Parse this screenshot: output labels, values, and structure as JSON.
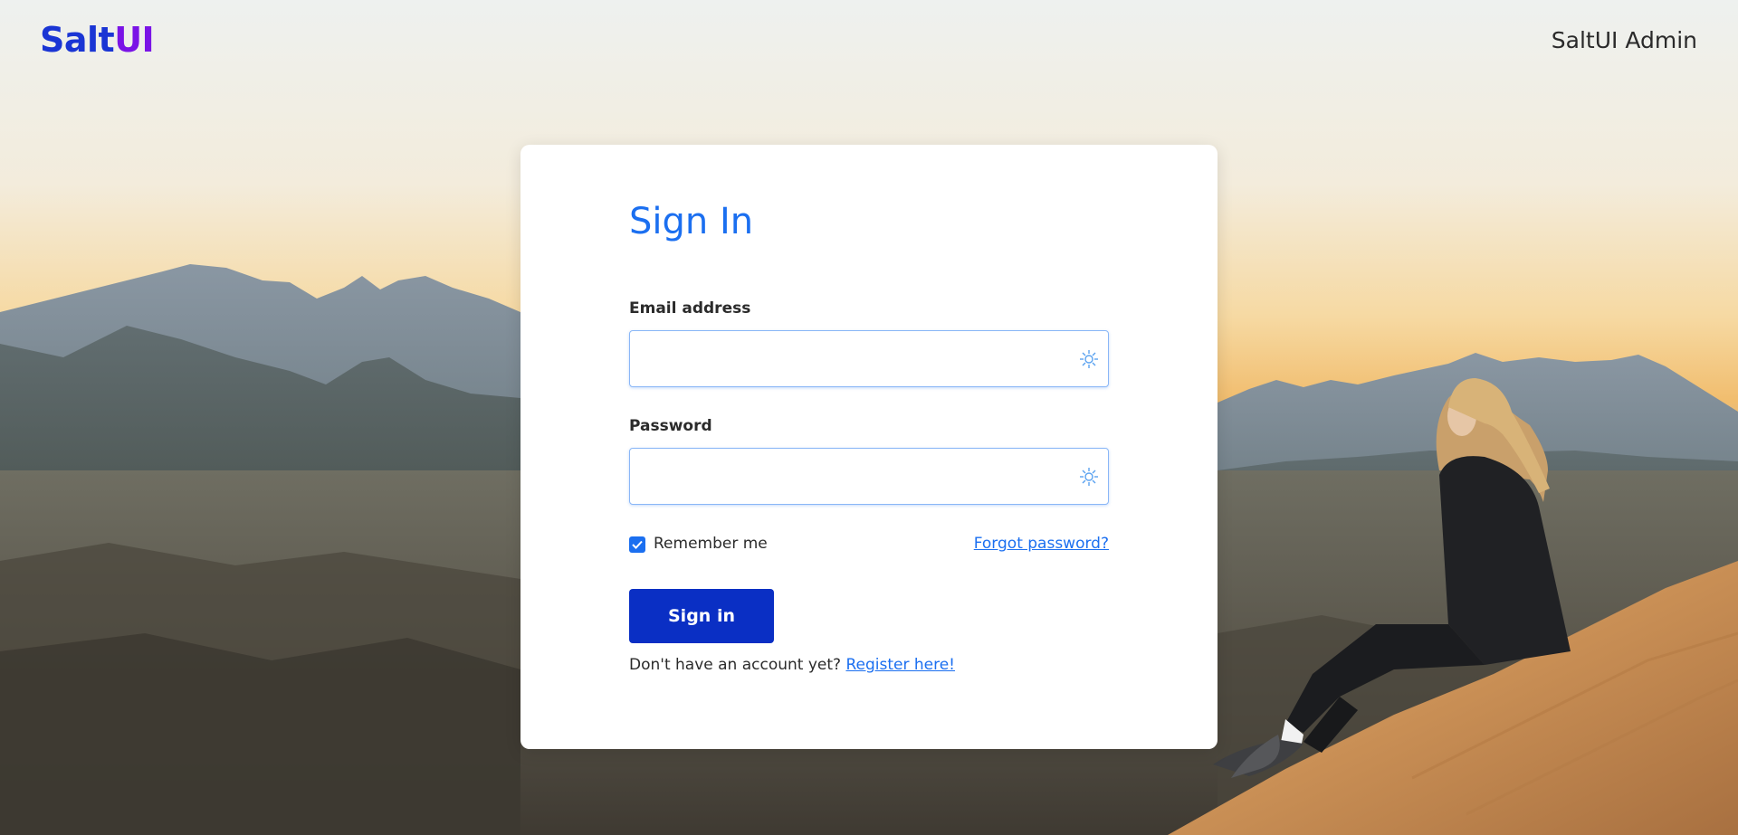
{
  "header": {
    "logo_part1": "Salt",
    "logo_part2": "UI",
    "app_title": "SaltUI Admin"
  },
  "form": {
    "title": "Sign In",
    "email_label": "Email address",
    "email_value": "",
    "email_field_icon": "password-manager-icon",
    "password_label": "Password",
    "password_value": "",
    "password_field_icon": "password-manager-icon",
    "remember_label": "Remember me",
    "remember_checked": true,
    "forgot_label": "Forgot password?",
    "submit_label": "Sign in",
    "register_prompt": "Don't have an account yet?",
    "register_link": "Register here!"
  },
  "colors": {
    "accent": "#1b6ff0",
    "button": "#0a2fc4",
    "logo_salt": "#1a35d4",
    "logo_ui": "#7a14e6"
  },
  "background": {
    "icon": "desert-mountain-sunset-photo"
  }
}
